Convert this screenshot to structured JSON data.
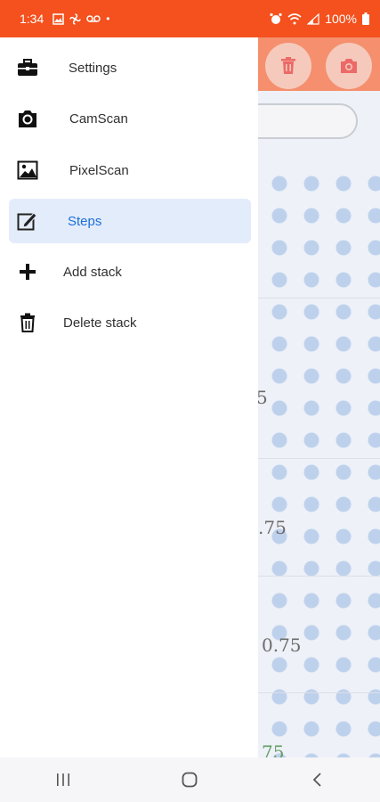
{
  "status_bar": {
    "time": "1:34",
    "battery": "100%"
  },
  "drawer": {
    "items": [
      {
        "label": "Settings",
        "icon": "briefcase-icon"
      },
      {
        "label": "CamScan",
        "icon": "camera-icon"
      },
      {
        "label": "PixelScan",
        "icon": "image-icon"
      },
      {
        "label": "Steps",
        "icon": "edit-icon",
        "active": true
      },
      {
        "label": "Add stack",
        "icon": "plus-icon"
      },
      {
        "label": "Delete stack",
        "icon": "trash-icon"
      }
    ]
  },
  "background_app": {
    "values": [
      "5",
      ".75",
      "0.75",
      "75"
    ]
  },
  "colors": {
    "accent": "#f4511e",
    "active_bg": "#e3ecfb",
    "active_text": "#1c6fd6"
  }
}
